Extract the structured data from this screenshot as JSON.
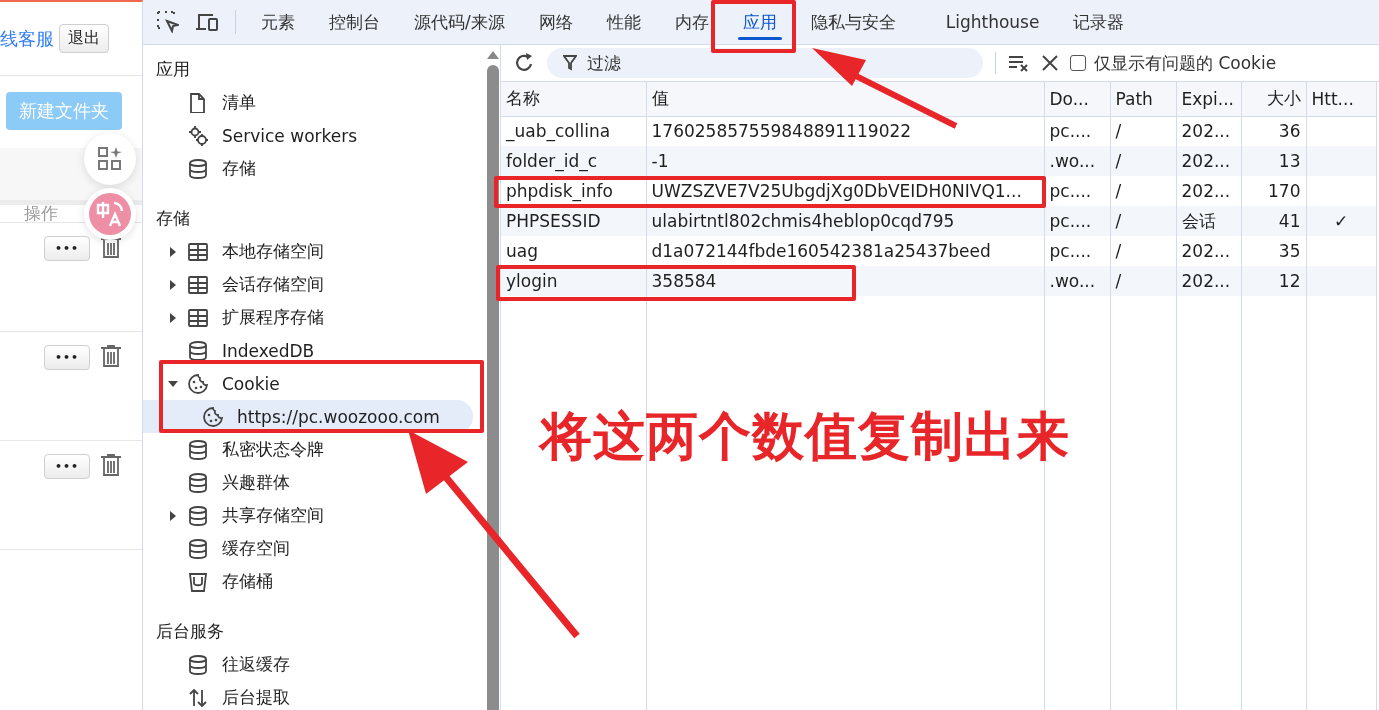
{
  "web_page": {
    "service_link": "线客服",
    "logout_button": "退出",
    "new_folder_button": "新建文件夹",
    "column_header": "操作",
    "rows": [
      {
        "more_button": "•••"
      },
      {
        "more_button": "•••"
      },
      {
        "more_button": "•••"
      }
    ]
  },
  "devtools": {
    "tabs": [
      {
        "label": "元素",
        "selected": false
      },
      {
        "label": "控制台",
        "selected": false
      },
      {
        "label": "源代码/来源",
        "selected": false
      },
      {
        "label": "网络",
        "selected": false
      },
      {
        "label": "性能",
        "selected": false
      },
      {
        "label": "内存",
        "selected": false
      },
      {
        "label": "应用",
        "selected": true
      },
      {
        "label": "隐私与安全",
        "selected": false
      },
      {
        "label": "Lighthouse",
        "selected": false
      },
      {
        "label": "记录器",
        "selected": false
      }
    ],
    "sidebar": [
      {
        "title": "应用",
        "items": [
          {
            "label": "清单",
            "kind": "file",
            "selected": false
          },
          {
            "label": "Service workers",
            "kind": "gears",
            "selected": false
          },
          {
            "label": "存储",
            "kind": "database",
            "selected": false
          }
        ]
      },
      {
        "title": "存储",
        "items": [
          {
            "label": "本地存储空间",
            "kind": "table",
            "expanded": false,
            "selected": false
          },
          {
            "label": "会话存储空间",
            "kind": "table",
            "expanded": false,
            "selected": false
          },
          {
            "label": "扩展程序存储",
            "kind": "table",
            "expanded": false,
            "selected": false
          },
          {
            "label": "IndexedDB",
            "kind": "database",
            "selected": false
          },
          {
            "label": "Cookie",
            "kind": "cookie",
            "expanded": true,
            "selected": false,
            "children": [
              {
                "label": "https://pc.woozooo.com",
                "kind": "cookie",
                "selected": true
              }
            ]
          },
          {
            "label": "私密状态令牌",
            "kind": "database",
            "selected": false
          },
          {
            "label": "兴趣群体",
            "kind": "database",
            "selected": false
          },
          {
            "label": "共享存储空间",
            "kind": "database",
            "expanded": false,
            "selected": false
          },
          {
            "label": "缓存空间",
            "kind": "database",
            "selected": false
          },
          {
            "label": "存储桶",
            "kind": "bucket",
            "selected": false
          }
        ]
      },
      {
        "title": "后台服务",
        "items": [
          {
            "label": "往返缓存",
            "kind": "database",
            "selected": false
          },
          {
            "label": "后台提取",
            "kind": "transfer",
            "selected": false
          }
        ]
      }
    ],
    "toolbar": {
      "filter_placeholder": "过滤",
      "issues_only_checkbox": {
        "label": "仅显示有问题的 Cookie",
        "checked": false
      }
    },
    "table": {
      "columns": [
        "名称",
        "值",
        "Do...",
        "Path",
        "Expi...",
        "大小",
        "Htt..."
      ],
      "rows": [
        [
          "_uab_collina",
          "176025857559848891119022",
          "pc....",
          "/",
          "202...",
          "36",
          ""
        ],
        [
          "folder_id_c",
          "-1",
          ".wo...",
          "/",
          "202...",
          "13",
          ""
        ],
        [
          "phpdisk_info",
          "UWZSZVE7V25UbgdjXg0DbVEIDH0NIVQ1...",
          "pc....",
          "/",
          "202...",
          "170",
          ""
        ],
        [
          "PHPSESSID",
          "ulabirtntl802chmis4heblop0cqd795",
          "pc....",
          "/",
          "会话",
          "41",
          "✓"
        ],
        [
          "uag",
          "d1a072144fbde160542381a25437beed",
          "pc....",
          "/",
          "202...",
          "35",
          ""
        ],
        [
          "ylogin",
          "358584",
          ".wo...",
          "/",
          "202...",
          "12",
          ""
        ]
      ]
    }
  },
  "annotation": {
    "text": "将这两个数值复制出来"
  }
}
